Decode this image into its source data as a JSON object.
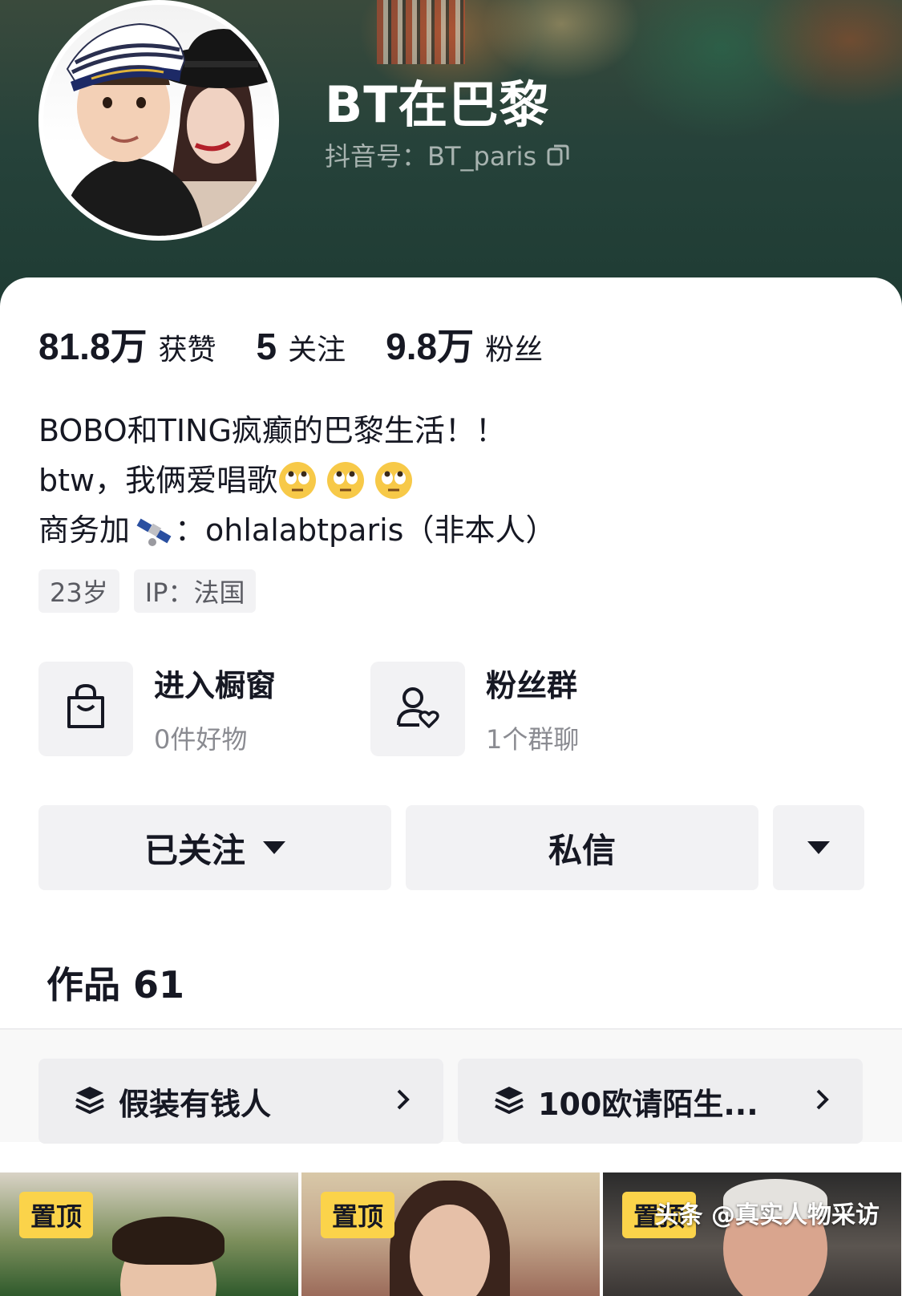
{
  "profile": {
    "nickname": "BT在巴黎",
    "douyin_id": "抖音号：BT_paris"
  },
  "stats": [
    {
      "value": "81.8万",
      "label": "获赞"
    },
    {
      "value": "5",
      "label": "关注"
    },
    {
      "value": "9.8万",
      "label": "粉丝"
    }
  ],
  "bio": {
    "line1": "BOBO和TING疯癫的巴黎生活！！",
    "line2_text": "btw，我俩爱唱歌",
    "line2_emoji": "face-with-rolling-eyes-emoji",
    "line3_prefix": "商务加",
    "line3_emoji": "satellite-emoji",
    "line3_suffix": "：ohlalabtparis（非本人）"
  },
  "tags": {
    "age": "23岁",
    "ip": "IP：法国"
  },
  "services": {
    "shop": {
      "title": "进入橱窗",
      "subtitle": "0件好物",
      "icon": "shopping-bag-icon"
    },
    "fan_group": {
      "title": "粉丝群",
      "subtitle": "1个群聊",
      "icon": "user-heart-icon"
    }
  },
  "actions": {
    "followed": "已关注",
    "message": "私信"
  },
  "works": {
    "title": "作品 61"
  },
  "collections": [
    {
      "label": "假装有钱人",
      "icon": "layers-icon"
    },
    {
      "label": "100欧请陌生...",
      "icon": "layers-icon"
    }
  ],
  "videos": [
    {
      "pin": "置顶"
    },
    {
      "pin": "置顶"
    },
    {
      "pin": "置顶"
    }
  ],
  "watermark": "头条 @真实人物采访",
  "colors": {
    "cover_green": "#1e3b33",
    "pin_yellow": "#fbd34a",
    "button_bg": "#f2f2f4",
    "text_primary": "#161823",
    "text_secondary": "#8a8b91"
  }
}
